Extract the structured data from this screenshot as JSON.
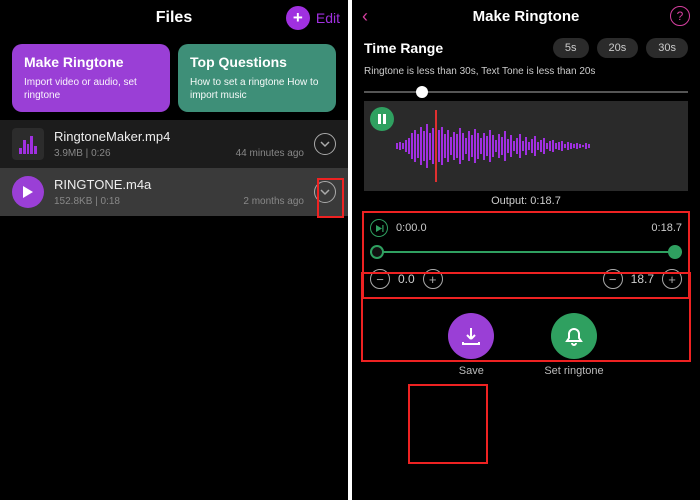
{
  "left": {
    "title": "Files",
    "edit": "Edit",
    "cards": [
      {
        "title": "Make Ringtone",
        "sub": "Import video or audio, set ringtone"
      },
      {
        "title": "Top Questions",
        "sub": "How to set a ringtone\nHow to import music"
      }
    ],
    "files": [
      {
        "name": "RingtoneMaker.mp4",
        "size": "3.9MB",
        "dur": "0:26",
        "ago": "44 minutes ago"
      },
      {
        "name": "RINGTONE.m4a",
        "size": "152.8KB",
        "dur": "0:18",
        "ago": "2 months ago"
      }
    ]
  },
  "right": {
    "title": "Make Ringtone",
    "range_label": "Time Range",
    "presets": [
      "5s",
      "20s",
      "30s"
    ],
    "hint": "Ringtone is less than 30s, Text Tone is less than 20s",
    "output_label": "Output:",
    "output_value": "0:18.7",
    "trim": {
      "start": "0:00.0",
      "end": "0:18.7",
      "start_val": "0.0",
      "end_val": "18.7"
    },
    "actions": {
      "save": "Save",
      "set": "Set ringtone"
    }
  }
}
